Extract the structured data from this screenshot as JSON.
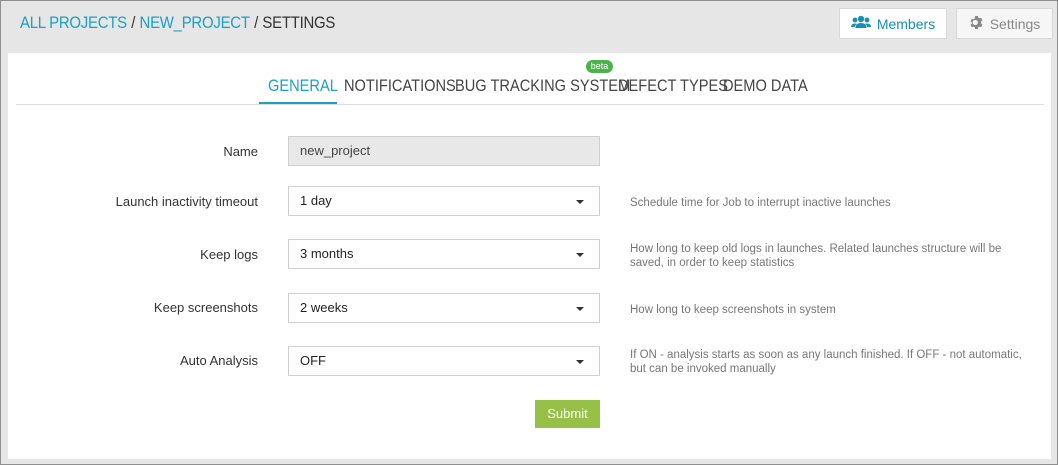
{
  "breadcrumb": {
    "all_projects": "ALL PROJECTS",
    "separator": "/",
    "project": "NEW_PROJECT",
    "current": "SETTINGS"
  },
  "top_buttons": {
    "members_label": "Members",
    "members_icon": "users-icon",
    "settings_label": "Settings",
    "settings_icon": "gear-icon"
  },
  "tabs": [
    {
      "label": "GENERAL",
      "active": true
    },
    {
      "label": "NOTIFICATIONS",
      "active": false
    },
    {
      "label": "BUG TRACKING SYSTEM",
      "active": false,
      "badge": "beta"
    },
    {
      "label": "DEFECT TYPES",
      "active": false
    },
    {
      "label": "DEMO DATA",
      "active": false
    }
  ],
  "form": {
    "name": {
      "label": "Name",
      "value": "new_project"
    },
    "launch_timeout": {
      "label": "Launch inactivity timeout",
      "value": "1 day",
      "help": "Schedule time for Job to interrupt inactive launches"
    },
    "keep_logs": {
      "label": "Keep logs",
      "value": "3 months",
      "help": "How long to keep old logs in launches. Related launches structure will be saved, in order to keep statistics"
    },
    "keep_screenshots": {
      "label": "Keep screenshots",
      "value": "2 weeks",
      "help": "How long to keep screenshots in system"
    },
    "auto_analysis": {
      "label": "Auto Analysis",
      "value": "OFF",
      "help": "If ON - analysis starts as soon as any launch finished. If OFF - not automatic, but can be invoked manually"
    },
    "submit_label": "Submit"
  },
  "colors": {
    "accent": "#1aa0c4",
    "submit": "#97c046",
    "beta_badge": "#4cb34c"
  }
}
